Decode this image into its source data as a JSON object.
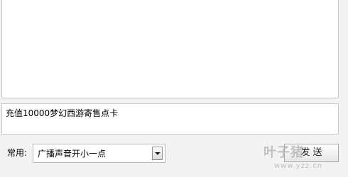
{
  "chat": {
    "input_text": "充值10000梦幻西游寄售点卡"
  },
  "common": {
    "label": "常用:",
    "selected": "广播声音开小一点"
  },
  "send": {
    "label": "发 送"
  },
  "watermark": {
    "text": "叶子猪",
    "url": "www.yzz.cn"
  }
}
